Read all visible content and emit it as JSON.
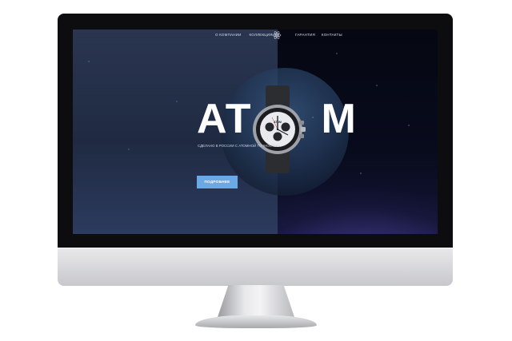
{
  "nav": {
    "left": [
      "О КОМПАНИИ",
      "КОЛЛЕКЦИЯ"
    ],
    "right": [
      "ГАРАНТИЯ",
      "КОНТАКТЫ"
    ]
  },
  "hero": {
    "title_left": "AT",
    "title_right": "M",
    "tagline": "СДЕЛАНО В РОССИИ С АТОМНОЙ ТОЧНОСТЬЮ.",
    "cta_label": "ПОДРОБНЕЕ"
  },
  "watch": {
    "dial_brand": "ATOM"
  },
  "colors": {
    "accent": "#6aa9e6",
    "screen_bg": "#1f2a42",
    "bezel": "#0d0d0f",
    "monitor_body": "#d9dadd"
  }
}
